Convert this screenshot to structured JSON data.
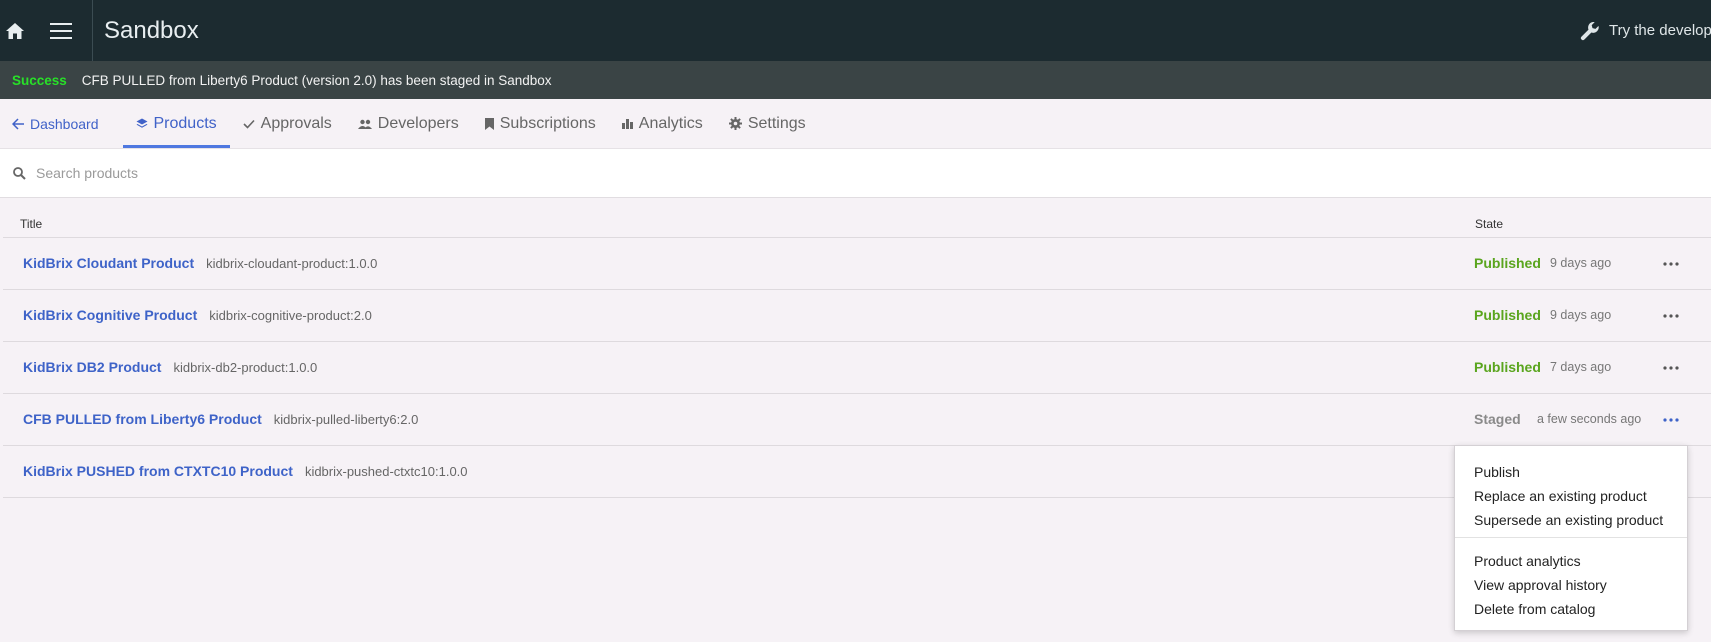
{
  "header": {
    "title": "Sandbox",
    "try_label": "Try the developer portal"
  },
  "banner": {
    "status": "Success",
    "message": "CFB PULLED from Liberty6 Product (version 2.0) has been staged in Sandbox"
  },
  "tabs": [
    {
      "label": "Dashboard",
      "icon": "arrow-left-icon"
    },
    {
      "label": "Products",
      "icon": "layers-icon",
      "active": true
    },
    {
      "label": "Approvals",
      "icon": "check-icon"
    },
    {
      "label": "Developers",
      "icon": "people-icon"
    },
    {
      "label": "Subscriptions",
      "icon": "bookmark-icon"
    },
    {
      "label": "Analytics",
      "icon": "bar-chart-icon"
    },
    {
      "label": "Settings",
      "icon": "gear-icon"
    }
  ],
  "search": {
    "placeholder": "Search products"
  },
  "table": {
    "columns": {
      "title": "Title",
      "state": "State"
    },
    "rows": [
      {
        "name": "KidBrix Cloudant Product",
        "id": "kidbrix-cloudant-product:1.0.0",
        "state": "Published",
        "time": "9 days ago"
      },
      {
        "name": "KidBrix Cognitive Product",
        "id": "kidbrix-cognitive-product:2.0",
        "state": "Published",
        "time": "9 days ago"
      },
      {
        "name": "KidBrix DB2 Product",
        "id": "kidbrix-db2-product:1.0.0",
        "state": "Published",
        "time": "7 days ago"
      },
      {
        "name": "CFB PULLED from Liberty6 Product",
        "id": "kidbrix-pulled-liberty6:2.0",
        "state": "Staged",
        "time": "a few seconds ago"
      },
      {
        "name": "KidBrix PUSHED from CTXTC10 Product",
        "id": "kidbrix-pushed-ctxtc10:1.0.0",
        "state": "",
        "time": ""
      }
    ]
  },
  "menu": {
    "items": [
      "Publish",
      "Replace an existing product",
      "Supersede an existing product"
    ],
    "items2": [
      "Product analytics",
      "View approval history",
      "Delete from catalog"
    ]
  },
  "colors": {
    "topbar": "#1c2b30",
    "banner": "#3a4445",
    "success": "#28e028",
    "link": "#3e63c8",
    "published": "#5aa51e",
    "staged": "#8a8a8a"
  }
}
